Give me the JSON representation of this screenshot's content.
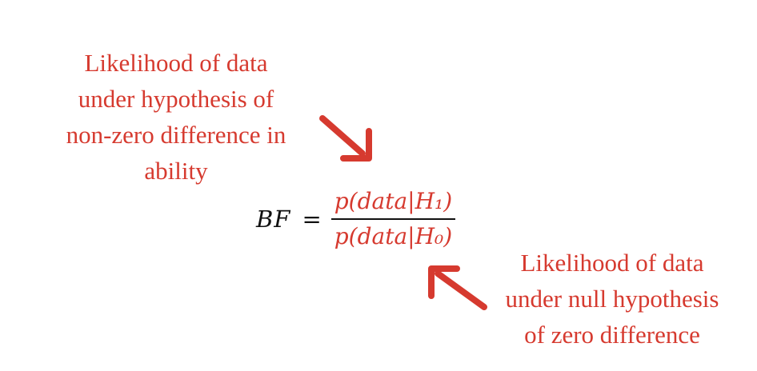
{
  "annotations": {
    "numerator_note": {
      "lines": [
        "Likelihood of data",
        "under hypothesis of",
        "non-zero difference in",
        "ability"
      ]
    },
    "denominator_note": {
      "lines": [
        "Likelihood of data",
        "under null hypothesis",
        "of zero difference"
      ]
    }
  },
  "equation": {
    "lhs": "BF",
    "equals": "=",
    "numerator": "p(data|H₁)",
    "denominator": "p(data|H₀)"
  },
  "colors": {
    "annotation": "#d63a2f",
    "equation_text": "#111111"
  }
}
